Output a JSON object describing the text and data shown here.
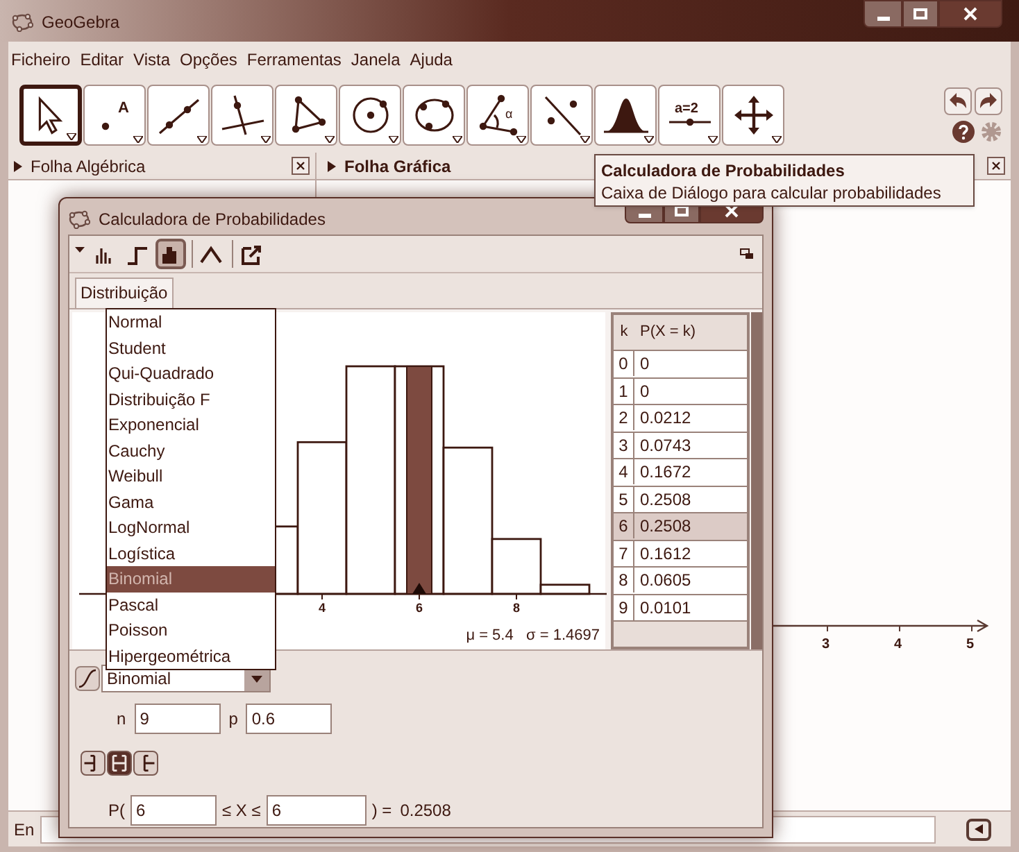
{
  "window": {
    "title": "GeoGebra"
  },
  "menu": [
    "Ficheiro",
    "Editar",
    "Vista",
    "Opções",
    "Ferramentas",
    "Janela",
    "Ajuda"
  ],
  "tools": [
    {
      "kind": "pointer",
      "selected": true
    },
    {
      "kind": "point",
      "label": "A",
      "selected": false
    },
    {
      "kind": "line",
      "selected": false
    },
    {
      "kind": "perpendicular",
      "selected": false
    },
    {
      "kind": "polygon",
      "selected": false
    },
    {
      "kind": "circle",
      "selected": false
    },
    {
      "kind": "conic",
      "selected": false
    },
    {
      "kind": "angle",
      "label": "α",
      "selected": false
    },
    {
      "kind": "reflect",
      "selected": false
    },
    {
      "kind": "distribution",
      "selected": false
    },
    {
      "kind": "slider",
      "label": "a=2",
      "selected": false
    },
    {
      "kind": "move",
      "selected": false
    }
  ],
  "panels": [
    {
      "title": "Folha Algébrica"
    },
    {
      "title": "Folha Gráfica"
    }
  ],
  "tooltip": {
    "title": "Calculadora de Probabilidades",
    "description": "Caixa de Diálogo para calcular probabilidades"
  },
  "graphics": {
    "x_ticks": [
      "3",
      "4",
      "5"
    ]
  },
  "input_bar": {
    "label": "En"
  },
  "dialog": {
    "title": "Calculadora de Probabilidades",
    "view_buttons": [
      {
        "kind": "bars",
        "selected": false
      },
      {
        "kind": "step",
        "selected": false
      },
      {
        "kind": "histogram",
        "selected": true
      },
      {
        "kind": "curve",
        "selected": false
      },
      {
        "kind": "export",
        "selected": false
      }
    ],
    "tab": "Distribuição",
    "distributions": [
      {
        "label": "Normal",
        "selected": false
      },
      {
        "label": "Student",
        "selected": false
      },
      {
        "label": "Qui-Quadrado",
        "selected": false
      },
      {
        "label": "Distribuição F",
        "selected": false
      },
      {
        "label": "Exponencial",
        "selected": false
      },
      {
        "label": "Cauchy",
        "selected": false
      },
      {
        "label": "Weibull",
        "selected": false
      },
      {
        "label": "Gama",
        "selected": false
      },
      {
        "label": "LogNormal",
        "selected": false
      },
      {
        "label": "Logística",
        "selected": false
      },
      {
        "label": "Binomial",
        "selected": true
      },
      {
        "label": "Pascal",
        "selected": false
      },
      {
        "label": "Poisson",
        "selected": false
      },
      {
        "label": "Hipergeométrica",
        "selected": false
      }
    ],
    "plot": {
      "x_ticks": [
        "4",
        "6",
        "8"
      ],
      "stats": "μ = 5.4   σ = 1.4697"
    },
    "table": {
      "columns": [
        "k",
        "P(X = k)"
      ],
      "rows": [
        {
          "k": "0",
          "p": "0",
          "selected": false
        },
        {
          "k": "1",
          "p": "0",
          "selected": false
        },
        {
          "k": "2",
          "p": "0.0212",
          "selected": false
        },
        {
          "k": "3",
          "p": "0.0743",
          "selected": false
        },
        {
          "k": "4",
          "p": "0.1672",
          "selected": false
        },
        {
          "k": "5",
          "p": "0.2508",
          "selected": false
        },
        {
          "k": "6",
          "p": "0.2508",
          "selected": true
        },
        {
          "k": "7",
          "p": "0.1612",
          "selected": false
        },
        {
          "k": "8",
          "p": "0.0605",
          "selected": false
        },
        {
          "k": "9",
          "p": "0.0101",
          "selected": false
        }
      ]
    },
    "distribution_select": {
      "value": "Binomial"
    },
    "parameters": [
      {
        "label": "n",
        "value": "9"
      },
      {
        "label": "p",
        "value": "0.6"
      }
    ],
    "interval_buttons": [
      {
        "kind": "left",
        "selected": false
      },
      {
        "kind": "interval",
        "selected": true
      },
      {
        "kind": "right",
        "selected": false
      }
    ],
    "probability": {
      "prefix": "P(",
      "low": "6",
      "middle": "≤ X ≤",
      "high": "6",
      "suffix": ") =",
      "result": "0.2508"
    }
  }
}
